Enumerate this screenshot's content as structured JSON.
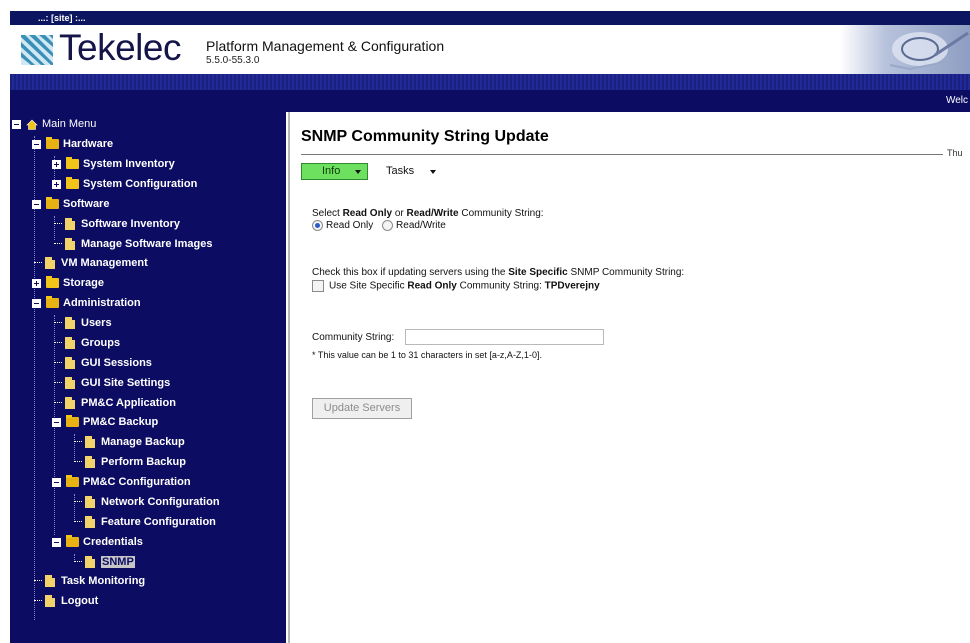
{
  "window": {
    "title": "...: [site] :..."
  },
  "header": {
    "brand": "Tekelec",
    "product": "Platform Management & Configuration",
    "version": "5.5.0-55.3.0",
    "welcome": "Welc"
  },
  "sidebar": {
    "items": [
      {
        "label": "Main Menu"
      },
      {
        "label": "Hardware"
      },
      {
        "label": "System Inventory"
      },
      {
        "label": "System Configuration"
      },
      {
        "label": "Software"
      },
      {
        "label": "Software Inventory"
      },
      {
        "label": "Manage Software Images"
      },
      {
        "label": "VM Management"
      },
      {
        "label": "Storage"
      },
      {
        "label": "Administration"
      },
      {
        "label": "Users"
      },
      {
        "label": "Groups"
      },
      {
        "label": "GUI Sessions"
      },
      {
        "label": "GUI Site Settings"
      },
      {
        "label": "PM&C Application"
      },
      {
        "label": "PM&C Backup"
      },
      {
        "label": "Manage Backup"
      },
      {
        "label": "Perform Backup"
      },
      {
        "label": "PM&C Configuration"
      },
      {
        "label": "Network Configuration"
      },
      {
        "label": "Feature Configuration"
      },
      {
        "label": "Credentials"
      },
      {
        "label": "SNMP"
      },
      {
        "label": "Task Monitoring"
      },
      {
        "label": "Logout"
      }
    ]
  },
  "main": {
    "title": "SNMP Community String Update",
    "date_fragment": "Thu",
    "menu": {
      "info": "Info",
      "tasks": "Tasks"
    },
    "select_prompt": {
      "a": "Select ",
      "b": "Read Only",
      "c": " or ",
      "d": "Read/Write",
      "e": " Community String:"
    },
    "radio_read_only": "Read Only",
    "radio_read_write": "Read/Write",
    "check_prompt": {
      "a": "Check this box if updating servers using the ",
      "b": "Site Specific",
      "c": " SNMP Community String:"
    },
    "checkbox_label": {
      "a": "Use Site Specific ",
      "b": "Read Only",
      "c": " Community String: ",
      "d": "TPDverejny"
    },
    "community_label": "Community String:",
    "community_value": "",
    "hint": "* This value can be 1 to 31 characters in set [a-z,A-Z,1-0].",
    "update_button": "Update Servers"
  },
  "colors": {
    "nav_background": "#0c0c63",
    "info_menu_green": "#6ee05f",
    "radio_selected": "#2c5bcc"
  }
}
